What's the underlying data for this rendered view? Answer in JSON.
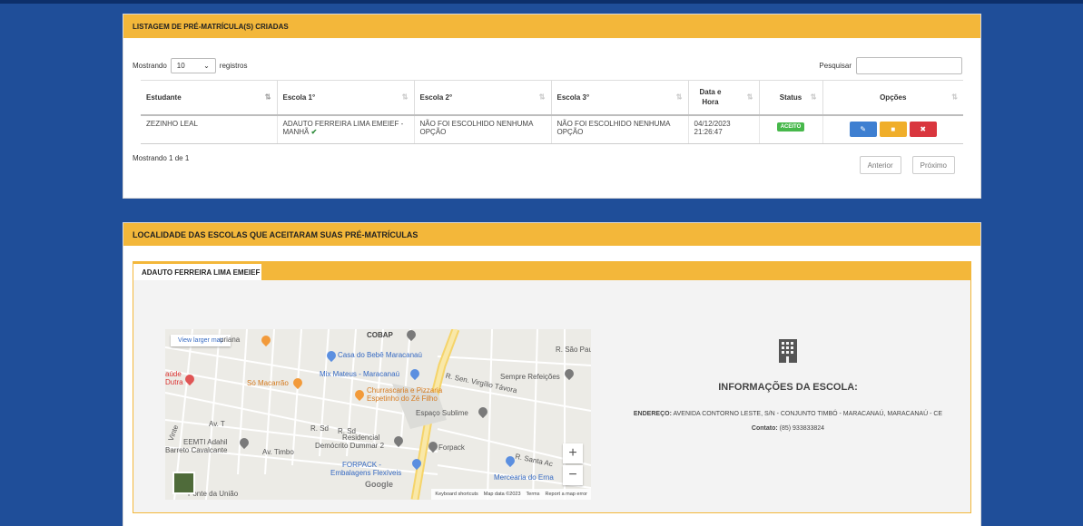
{
  "panel1": {
    "title": "LISTAGEM DE PRÉ-MATRÍCULA(S) CRIADAS",
    "length_prefix": "Mostrando",
    "length_value": "10",
    "length_suffix": "registros",
    "search_label": "Pesquisar",
    "search_value": "",
    "columns": [
      "Estudante",
      "Escola 1°",
      "Escola 2°",
      "Escola 3°",
      "Data e Hora",
      "Status",
      "Opções"
    ],
    "rows": [
      {
        "estudante": "ZEZINHO LEAL",
        "escola1": "ADAUTO FERREIRA LIMA EMEIEF - MANHÃ",
        "escola2": "NÃO FOI ESCOLHIDO NENHUMA OPÇÃO",
        "escola3": "NÃO FOI ESCOLHIDO NENHUMA OPÇÃO",
        "data": "04/12/2023",
        "hora": "21:26:47",
        "status": "ACEITO"
      }
    ],
    "info": "Mostrando 1 de 1",
    "prev_label": "Anterior",
    "next_label": "Próximo"
  },
  "panel2": {
    "title": "LOCALIDADE DAS ESCOLAS QUE ACEITARAM SUAS PRÉ-MATRÍCULAS",
    "tab_label": "ADAUTO FERREIRA LIMA EMEIEF",
    "map": {
      "view_larger": "View larger map",
      "labels": {
        "cobap": "COBAP",
        "casa": "Casa do Bebê Maracanaú",
        "mix": "Mix Mateus - Maracanaú",
        "so_macarrao": "Só Macarrão",
        "churrascaria1": "Churrascaria e Pizzaria",
        "churrascaria2": "Espetinho do Zé Filho",
        "sempre": "Sempre Refeições",
        "espaco": "Espaço Sublime",
        "residencial1": "Residencial",
        "residencial2": "Demócrito Dummar 2",
        "eemti1": "EEMTI Adahil",
        "eemti2": "Barreto Cavalcante",
        "timbo": "Av. Timbo",
        "forpack": "Forpack",
        "forpack2a": "FORPACK -",
        "forpack2b": "Embalagens Flexíveis",
        "mercearia": "Mercearia do Erna",
        "ponte": "Ponte da União",
        "saude": "aúde",
        "dutra": "Dutra",
        "uriana": "uriana",
        "sao_pau": "R. São Pau",
        "virgilio": "R. Sen. Virgílio Távora",
        "santa": "R. Santa Ac",
        "sd1": "R. Sd",
        "sd2": "R. Sd",
        "av": "Av. T",
        "vinte": "Vinte",
        "google": "Google",
        "attr_keyboard": "Keyboard shortcuts",
        "attr_data": "Map data ©2023",
        "attr_terms": "Terms",
        "attr_report": "Report a map error",
        "zoom_in": "+",
        "zoom_out": "−"
      }
    },
    "info_title": "INFORMAÇÕES DA ESCOLA:",
    "address_label": "ENDEREÇO:",
    "address": "AVENIDA CONTORNO LESTE, S/N - CONJUNTO TIMBÓ - MARACANAÚ, MARACANAÚ - CE",
    "contact_label": "Contato:",
    "contact": "(85) 933833824"
  },
  "colors": {
    "background": "#1f4e99",
    "panel_header": "#f3b73a",
    "btn_edit": "#3e7fd1",
    "btn_folder": "#f0ae2a",
    "btn_delete": "#d9363e",
    "status_accepted": "#47b84b"
  },
  "icons": [
    "sort-icon",
    "check-icon",
    "edit-icon",
    "folder-icon",
    "trash-icon",
    "building-icon",
    "chevron-down-icon"
  ]
}
